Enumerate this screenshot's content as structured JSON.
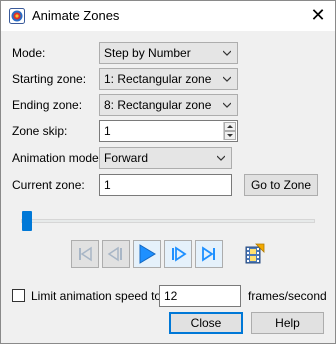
{
  "window": {
    "title": "Animate Zones",
    "close_glyph": "✕"
  },
  "mode": {
    "label": "Mode:",
    "value": "Step by Number"
  },
  "starting_zone": {
    "label": "Starting zone:",
    "value": "1: Rectangular zone"
  },
  "ending_zone": {
    "label": "Ending zone:",
    "value": "8: Rectangular zone"
  },
  "zone_skip": {
    "label": "Zone skip:",
    "value": "1"
  },
  "animation_mode": {
    "label": "Animation mode:",
    "value": "Forward"
  },
  "current_zone": {
    "label": "Current zone:",
    "value": "1",
    "goto_label": "Go to Zone"
  },
  "slider": {
    "position_fraction": 0.0
  },
  "transport": {
    "icons": [
      "skip-to-start-icon",
      "step-back-icon",
      "play-icon",
      "step-forward-icon",
      "skip-to-end-icon",
      "export-animation-icon"
    ]
  },
  "limit_speed": {
    "label": "Limit animation speed to",
    "value": "12",
    "unit": "frames/second",
    "checked": false
  },
  "buttons": {
    "close": "Close",
    "help": "Help"
  },
  "colors": {
    "accent": "#0078d7",
    "play_blue": "#1e90ff"
  }
}
